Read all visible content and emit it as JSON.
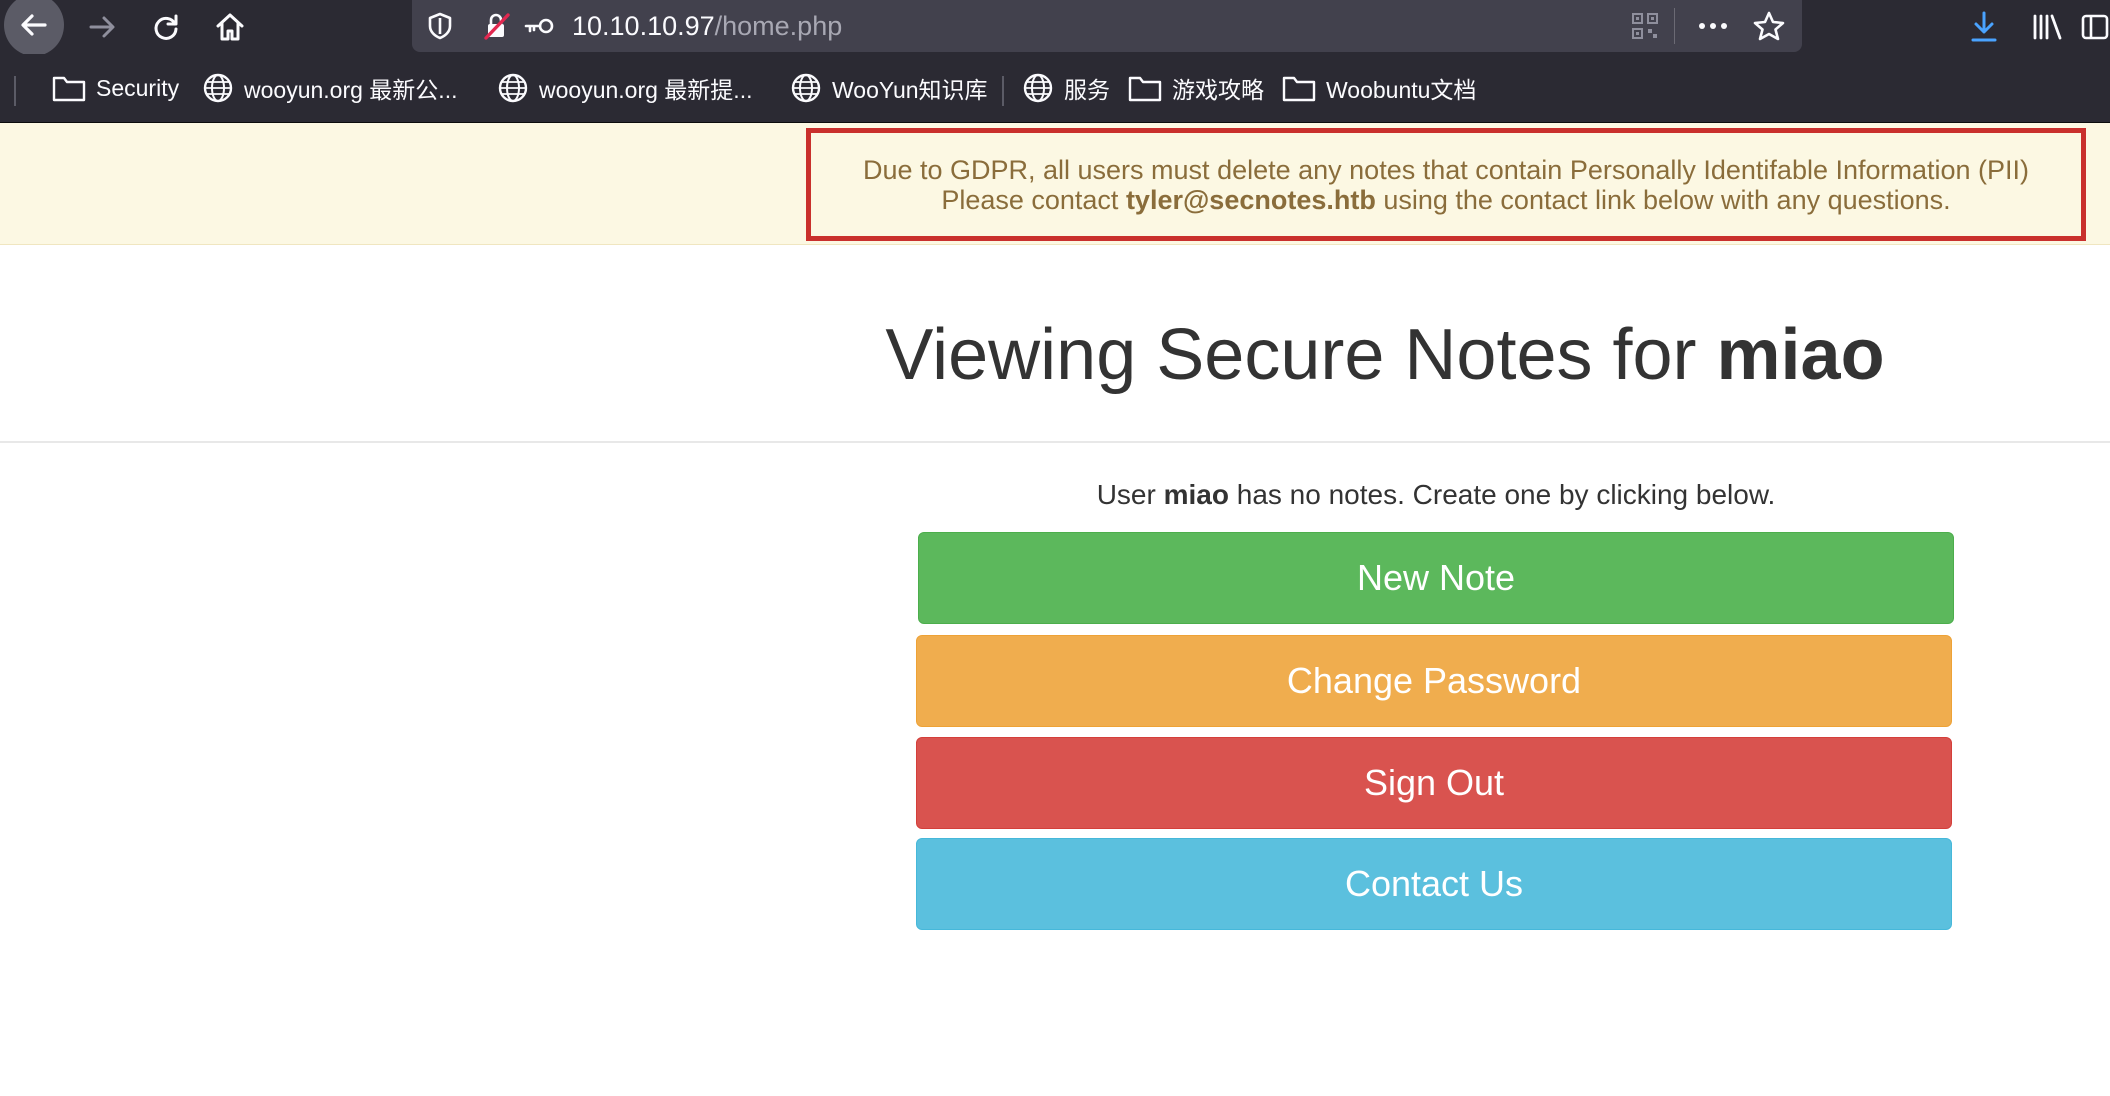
{
  "browser": {
    "url_host": "10.10.10.97",
    "url_path": "/home.php"
  },
  "bookmarks": [
    {
      "label": "Security",
      "icon": "folder-icon"
    },
    {
      "label": "wooyun.org 最新公...",
      "icon": "globe-icon"
    },
    {
      "label": "wooyun.org 最新提...",
      "icon": "globe-icon"
    },
    {
      "label": "WooYun知识库",
      "icon": "globe-icon"
    },
    {
      "label": "服务",
      "icon": "globe-icon"
    },
    {
      "label": "游戏攻略",
      "icon": "folder-icon"
    },
    {
      "label": "Woobuntu文档",
      "icon": "folder-icon"
    }
  ],
  "notice": {
    "line1": "Due to GDPR, all users must delete any notes that contain Personally Identifable Information (PII)",
    "line2_prefix": "Please contact ",
    "line2_email": "tyler@secnotes.htb",
    "line2_suffix": " using the contact link below with any questions."
  },
  "header": {
    "title_prefix": "Viewing Secure Notes for ",
    "username": "miao"
  },
  "status": {
    "prefix": "User ",
    "username": "miao",
    "suffix": " has no notes. Create one by clicking below."
  },
  "actions": {
    "new_note": "New Note",
    "change_password": "Change Password",
    "sign_out": "Sign Out",
    "contact_us": "Contact Us"
  },
  "colors": {
    "success": "#5cb85c",
    "warning": "#f0ad4e",
    "danger": "#d9534f",
    "info": "#5bc0de",
    "notice_bg": "#fcf8e3",
    "notice_text": "#8a6d3b",
    "notice_border": "#c9302c"
  }
}
